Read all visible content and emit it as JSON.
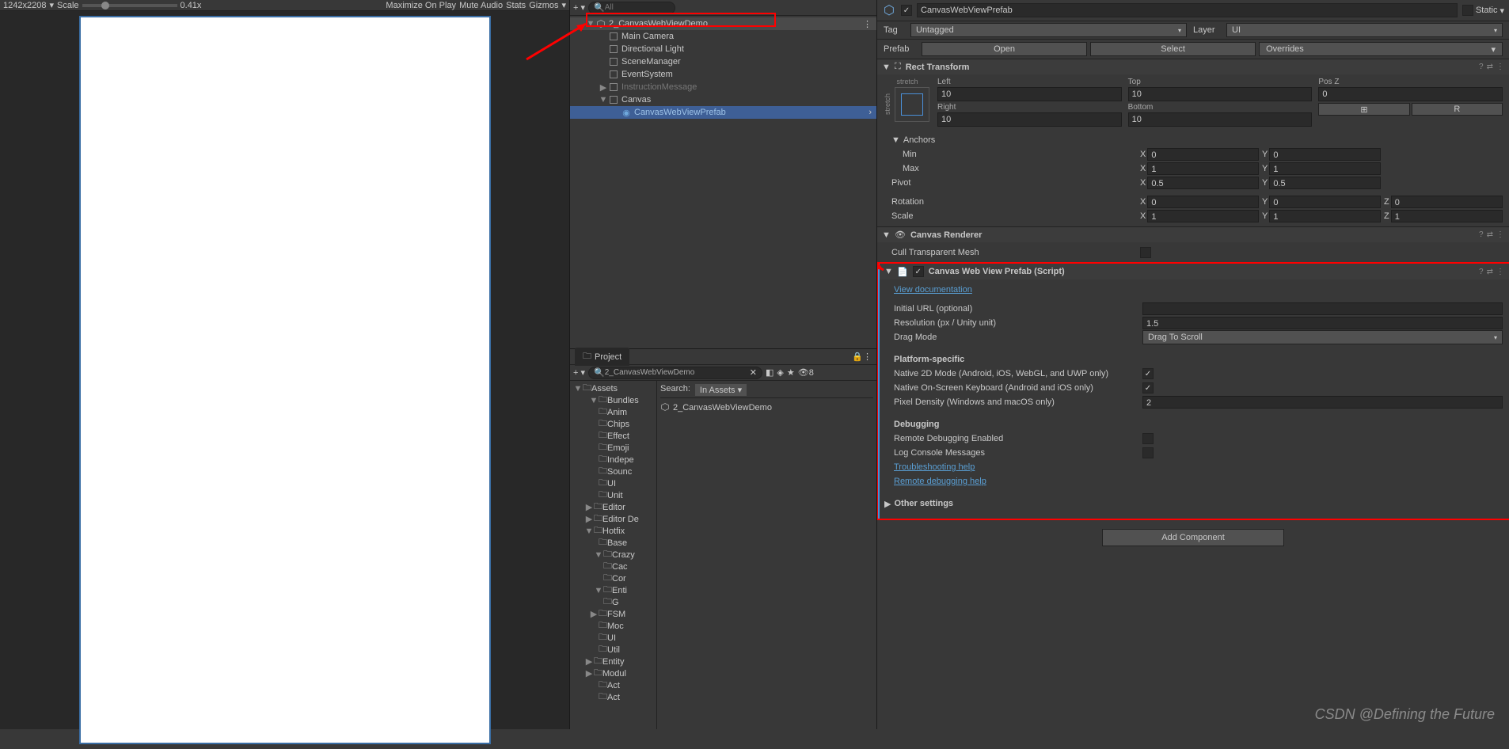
{
  "gameToolbar": {
    "resolution": "1242x2208",
    "scaleLabel": "Scale",
    "scaleValue": "0.41x",
    "maximize": "Maximize On Play",
    "mute": "Mute Audio",
    "stats": "Stats",
    "gizmos": "Gizmos"
  },
  "hierarchy": {
    "searchPlaceholder": "All",
    "sceneName": "2_CanvasWebViewDemo",
    "items": [
      {
        "name": "Main Camera",
        "indent": 2
      },
      {
        "name": "Directional Light",
        "indent": 2
      },
      {
        "name": "SceneManager",
        "indent": 2
      },
      {
        "name": "EventSystem",
        "indent": 2
      },
      {
        "name": "InstructionMessage",
        "indent": 2,
        "hasChildren": true,
        "greyed": true
      },
      {
        "name": "Canvas",
        "indent": 2,
        "hasChildren": true,
        "expanded": true
      },
      {
        "name": "CanvasWebViewPrefab",
        "indent": 3,
        "selected": true,
        "prefab": true,
        "arrow": true
      }
    ]
  },
  "project": {
    "tabLabel": "Project",
    "searchLabel": "Search:",
    "searchScope": "In Assets",
    "searchValue": "2_CanvasWebViewDemo",
    "root": "Assets",
    "folders": [
      "Bundles",
      "Anim",
      "Chips",
      "Effect",
      "Emoji",
      "Indepe",
      "Sounc",
      "UI",
      "Unit",
      "Editor",
      "Editor De",
      "Hotfix",
      "Base",
      "Crazy",
      "Cac",
      "Cor",
      "Enti",
      "G",
      "FSM",
      "Moc",
      "UI",
      "Util",
      "Entity",
      "Modul",
      "Act",
      "Act"
    ],
    "searchResult": "2_CanvasWebViewDemo"
  },
  "inspector": {
    "objectName": "CanvasWebViewPrefab",
    "staticLabel": "Static",
    "tagLabel": "Tag",
    "tagValue": "Untagged",
    "layerLabel": "Layer",
    "layerValue": "UI",
    "prefabLabel": "Prefab",
    "openBtn": "Open",
    "selectBtn": "Select",
    "overridesBtn": "Overrides",
    "rectTransform": {
      "title": "Rect Transform",
      "stretchH": "stretch",
      "stretchV": "stretch",
      "leftLabel": "Left",
      "leftVal": "10",
      "topLabel": "Top",
      "topVal": "10",
      "poszLabel": "Pos Z",
      "poszVal": "0",
      "rightLabel": "Right",
      "rightVal": "10",
      "bottomLabel": "Bottom",
      "bottomVal": "10",
      "anchorsLabel": "Anchors",
      "minLabel": "Min",
      "minX": "0",
      "minY": "0",
      "maxLabel": "Max",
      "maxX": "1",
      "maxY": "1",
      "pivotLabel": "Pivot",
      "pivotX": "0.5",
      "pivotY": "0.5",
      "rotationLabel": "Rotation",
      "rotX": "0",
      "rotY": "0",
      "rotZ": "0",
      "scaleLabel": "Scale",
      "scaleX": "1",
      "scaleY": "1",
      "scaleZ": "1"
    },
    "canvasRenderer": {
      "title": "Canvas Renderer",
      "cullLabel": "Cull Transparent Mesh"
    },
    "webView": {
      "title": "Canvas Web View Prefab (Script)",
      "viewDocs": "View documentation",
      "initialUrlLabel": "Initial URL (optional)",
      "resolutionLabel": "Resolution (px / Unity unit)",
      "resolutionVal": "1.5",
      "dragModeLabel": "Drag Mode",
      "dragModeVal": "Drag To Scroll",
      "platformHeader": "Platform-specific",
      "native2dLabel": "Native 2D Mode (Android, iOS, WebGL, and UWP only)",
      "keyboardLabel": "Native On-Screen Keyboard (Android and iOS only)",
      "pixelDensityLabel": "Pixel Density (Windows and macOS only)",
      "pixelDensityVal": "2",
      "debuggingHeader": "Debugging",
      "remoteDebugLabel": "Remote Debugging Enabled",
      "logConsoleLabel": "Log Console Messages",
      "troubleshootLink": "Troubleshooting help",
      "remoteDebugLink": "Remote debugging help",
      "otherSettings": "Other settings"
    },
    "addComponent": "Add Component"
  },
  "watermark": "CSDN @Defining the Future"
}
